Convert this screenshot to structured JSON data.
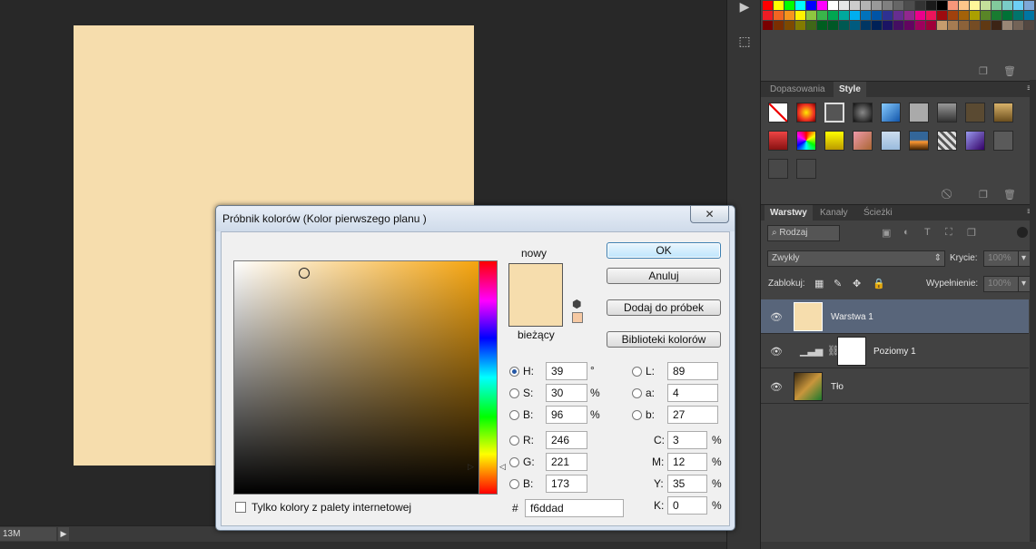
{
  "status": {
    "zoom": "13M",
    "arrow": "▶"
  },
  "mini_strip": {
    "play_icon": "▶",
    "cube_icon": "⬚"
  },
  "panels": {
    "swatch_colors": [
      [
        "#ff0000",
        "#ffff00",
        "#00ff00",
        "#00ffff",
        "#0000ff",
        "#ff00ff",
        "#ffffff",
        "#e6e6e6",
        "#cccccc",
        "#b3b3b3",
        "#999999",
        "#808080",
        "#666666",
        "#4d4d4d",
        "#333333",
        "#1a1a1a",
        "#000000",
        "#f7977a",
        "#fdc68a",
        "#fff79a",
        "#c4df9b",
        "#82ca9c",
        "#7accc8",
        "#6ecff6",
        "#7ea7d8"
      ],
      [
        "#ed1c24",
        "#f26522",
        "#f7941d",
        "#fff200",
        "#8dc63f",
        "#39b54a",
        "#00a651",
        "#00a99d",
        "#00aeef",
        "#0072bc",
        "#0054a6",
        "#2e3192",
        "#662d91",
        "#92278f",
        "#ec008c",
        "#ed145b",
        "#9e0b0f",
        "#a0410d",
        "#a36209",
        "#aba000",
        "#598527",
        "#197b30",
        "#007236",
        "#00746b",
        "#0076a3"
      ],
      [
        "#790000",
        "#7b2e00",
        "#7d4900",
        "#827b00",
        "#406618",
        "#005e20",
        "#005826",
        "#005952",
        "#005b7f",
        "#003663",
        "#002157",
        "#1b1464",
        "#440e62",
        "#630460",
        "#9e005d",
        "#9e0039",
        "#c69c6d",
        "#a67c52",
        "#8c6239",
        "#754c24",
        "#603913",
        "#3c2415",
        "#998675",
        "#736357",
        "#534741"
      ]
    ],
    "adjust_tab": "Dopasowania",
    "style_tab": "Style",
    "layers_tab": "Warstwy",
    "channels_tab": "Kanały",
    "paths_tab": "Ścieżki",
    "menu_icon": "≡",
    "kind_filter": "Rodzaj",
    "blend_mode": "Zwykły",
    "opacity_label": "Krycie:",
    "opacity_value": "100%",
    "lock_label": "Zablokuj:",
    "fill_label": "Wypełnienie:",
    "fill_value": "100%",
    "layers": [
      {
        "name": "Warstwa 1"
      },
      {
        "name": "Poziomy 1"
      },
      {
        "name": "Tło"
      }
    ]
  },
  "dialog": {
    "title": "Próbnik kolorów (Kolor pierwszego planu )",
    "close": "✕",
    "new_label": "nowy",
    "current_label": "bieżący",
    "ok": "OK",
    "cancel": "Anuluj",
    "add_swatch": "Dodaj do próbek",
    "libraries": "Biblioteki kolorów",
    "H": {
      "label": "H:",
      "value": "39",
      "unit": "°"
    },
    "S": {
      "label": "S:",
      "value": "30",
      "unit": "%"
    },
    "Bv": {
      "label": "B:",
      "value": "96",
      "unit": "%"
    },
    "R": {
      "label": "R:",
      "value": "246"
    },
    "G": {
      "label": "G:",
      "value": "221"
    },
    "Bc": {
      "label": "B:",
      "value": "173"
    },
    "L": {
      "label": "L:",
      "value": "89"
    },
    "a": {
      "label": "a:",
      "value": "4"
    },
    "b": {
      "label": "b:",
      "value": "27"
    },
    "C": {
      "label": "C:",
      "value": "3",
      "unit": "%"
    },
    "M": {
      "label": "M:",
      "value": "12",
      "unit": "%"
    },
    "Y": {
      "label": "Y:",
      "value": "35",
      "unit": "%"
    },
    "K": {
      "label": "K:",
      "value": "0",
      "unit": "%"
    },
    "hex_label": "#",
    "hex": "f6ddad",
    "web_only": "Tylko kolory z palety internetowej",
    "selected_color": "#f6ddad"
  }
}
